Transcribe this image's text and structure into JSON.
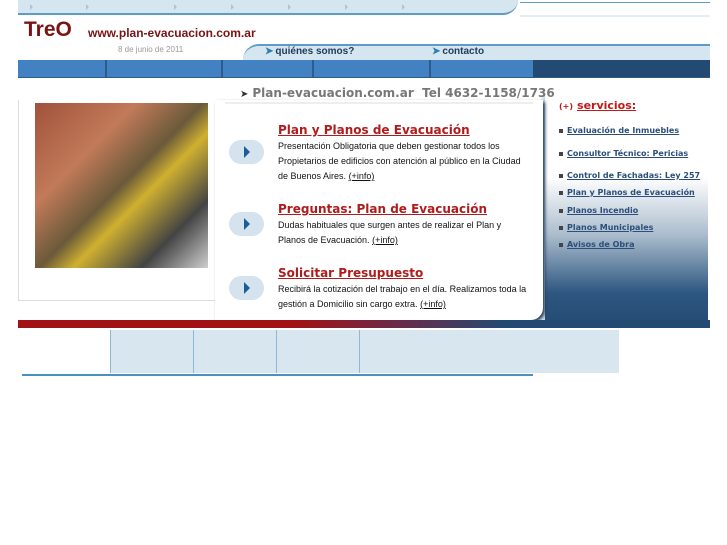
{
  "brand": {
    "logo": "TreO",
    "url": "www.plan-evacuacion.com.ar",
    "date": "8 de junio de 2011"
  },
  "nav": [
    {
      "label": "quiénes somos?"
    },
    {
      "label": "contacto"
    }
  ],
  "headline": "Plan-evacuacion.com.ar  Tel 4632-1158/1736",
  "items": [
    {
      "title": "Plan y Planos de Evacuación",
      "desc": "Presentación Obligatoria que deben gestionar todos los Propietarios de edificios con atención al público en la Ciudad de Buenos Aires.",
      "more": "(+info)"
    },
    {
      "title": "Preguntas: Plan de Evacuación",
      "desc": "Dudas habituales que surgen antes de realizar el Plan y Planos de Evacuación.",
      "more": "(+info)"
    },
    {
      "title": "Solicitar Presupuesto",
      "desc": "Recibirá la cotización del trabajo en el día. Realizamos toda la gestión a Domicilio sin cargo extra.",
      "more": "(+info)"
    }
  ],
  "services": {
    "plus": "(+)",
    "title": "servicios:",
    "items": [
      {
        "label": "Evaluación de Inmuebles"
      },
      {
        "label": "Consultor Técnico: Pericias"
      },
      {
        "label": "Control de Fachadas: Ley 257"
      },
      {
        "label": "Plan y Planos de Evacuación"
      },
      {
        "label": "Planos Incendio"
      },
      {
        "label": "Planos Municipales"
      },
      {
        "label": "Avisos de Obra"
      }
    ]
  },
  "colors": {
    "brand_red": "#7a1414",
    "accent_red": "#b01c1c",
    "nav_blue": "#4282c2",
    "dark_blue": "#234a72",
    "light_blue": "#d6e6f0"
  }
}
